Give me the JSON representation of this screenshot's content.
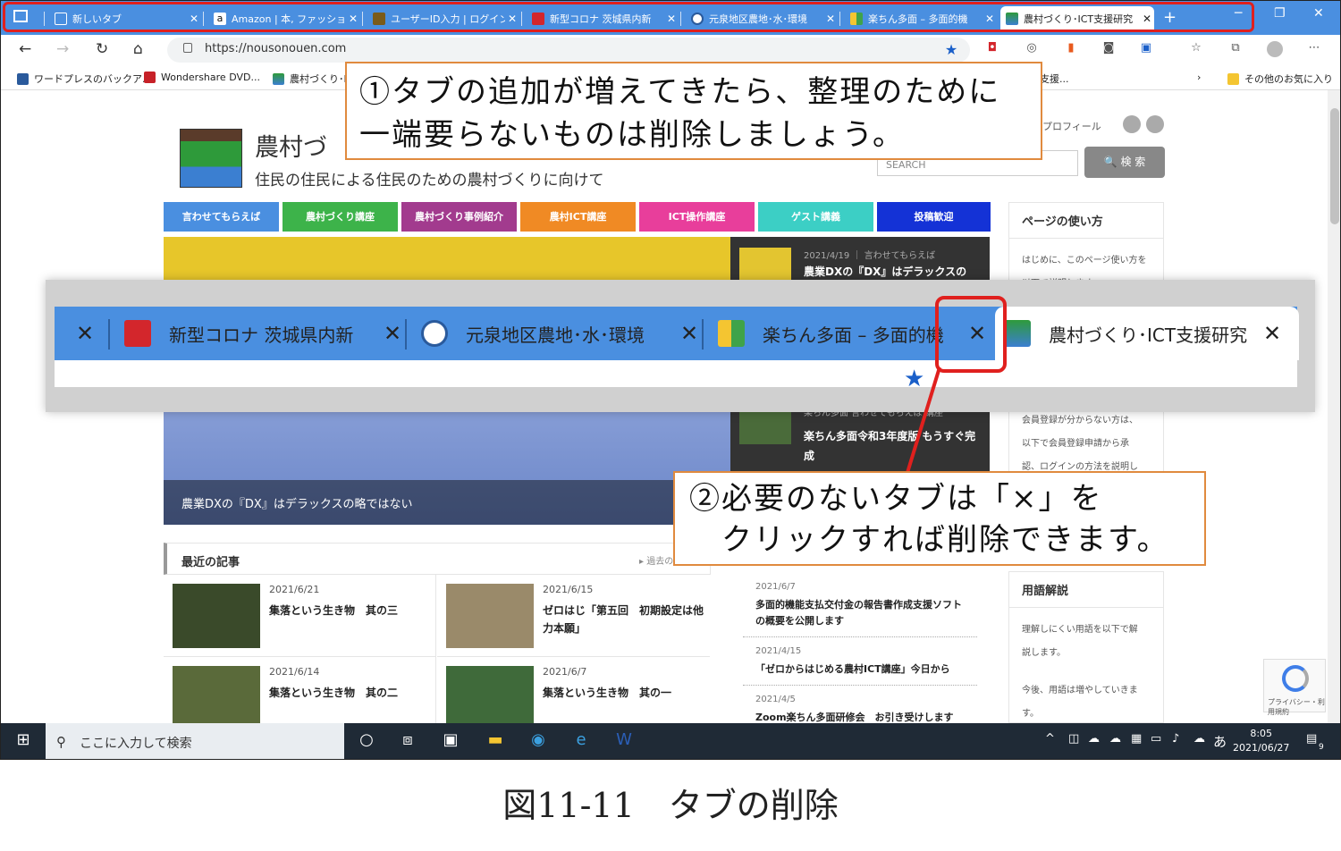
{
  "browser": {
    "tabs": [
      {
        "label": "新しいタブ",
        "color": "#ffffff"
      },
      {
        "label": "Amazon | 本, ファッション",
        "color": "#111111"
      },
      {
        "label": "ユーザーID入力 | ログイン",
        "color": "#7a5b1a"
      },
      {
        "label": "新型コロナ 茨城県内新",
        "color": "#d3262c"
      },
      {
        "label": "元泉地区農地･水･環境",
        "color": "#2a5a9c"
      },
      {
        "label": "楽ちん多面 – 多面的機",
        "color": "#f4c531"
      },
      {
        "label": "農村づくり･ICT支援研究",
        "color": "#3f9a3a"
      }
    ],
    "new_tab": "+",
    "window_controls": {
      "minimize": "─",
      "restore": "❐",
      "close": "✕"
    },
    "url": "https://nousonouen.com",
    "bookmarks": [
      {
        "label": "ワードプレスのバックア..."
      },
      {
        "label": "Wondershare DVD..."
      },
      {
        "label": "農村づくり･I("
      },
      {
        "label": "支援..."
      },
      {
        "label": "その他のお気に入り"
      }
    ]
  },
  "site": {
    "title": "農村づ",
    "tagline": "住民の住民による住民のための農村づくりに向けて",
    "profile": "プロフィール",
    "search_placeholder": "SEARCH",
    "search_button": "🔍 検 索",
    "nav": [
      {
        "label": "言わせてもらえば",
        "color": "#4a8fe0"
      },
      {
        "label": "農村づくり講座",
        "color": "#3db34a"
      },
      {
        "label": "農村づくり事例紹介",
        "color": "#a23b8e"
      },
      {
        "label": "農村ICT講座",
        "color": "#f08a24"
      },
      {
        "label": "ICT操作講座",
        "color": "#e83e9b"
      },
      {
        "label": "ゲスト講義",
        "color": "#3ccfc5"
      },
      {
        "label": "投稿歓迎",
        "color": "#1432d6"
      }
    ],
    "hero_caption": "農業DXの『DX』はデラックスの略ではない",
    "side_posts": [
      {
        "meta": "2021/4/19 ｜ 言わせてもらえば",
        "title": "農業DXの『DX』はデラックスの"
      },
      {
        "meta": "楽ちん多面 言わせてもらえば 講座",
        "title": "楽ちん多面令和3年度版 もうすぐ完成"
      }
    ],
    "page_usage": {
      "heading": "ページの使い方",
      "body": "はじめに、このページ使い方を以下で説明します。"
    },
    "member": {
      "body1": "会員登録が分からない方は、",
      "body2": "以下で会員登録申請から承",
      "body3": "認、ログインの方法を説明し"
    },
    "glossary": {
      "heading": "用語解説",
      "body1": "理解しにくい用語を以下で解",
      "body2": "説します。",
      "body3": "今後、用語は増やしていきま",
      "body4": "す。"
    },
    "recent_heading": "最近の記事",
    "recent_more": "▸ 過去の",
    "recent": [
      {
        "date": "2021/6/21",
        "title": "集落という生き物　其の三"
      },
      {
        "date": "2021/6/15",
        "title": "ゼロはじ「第五回　初期設定は他力本願」"
      },
      {
        "date": "2021/6/14",
        "title": "集落という生き物　其の二"
      },
      {
        "date": "2021/6/7",
        "title": "集落という生き物　其の一"
      }
    ],
    "news": [
      {
        "date": "2021/6/7",
        "title": "多面的機能支払交付金の報告書作成支援ソフトの概要を公開します"
      },
      {
        "date": "2021/4/15",
        "title": "「ゼロからはじめる農村ICT講座」今日から"
      },
      {
        "date": "2021/4/5",
        "title": "Zoom楽ちん多面研修会　お引き受けします"
      }
    ],
    "recaptcha_label": "プライバシー・利用規約"
  },
  "zoom": {
    "tabs": [
      {
        "label": "新型コロナ 茨城県内新",
        "color": "#d3262c"
      },
      {
        "label": "元泉地区農地･水･環境",
        "color": "#2a5a9c"
      },
      {
        "label": "楽ちん多面 – 多面的機",
        "color": "#f4c531"
      },
      {
        "label": "農村づくり･ICT支援研究",
        "color": "#3f9a3a"
      }
    ]
  },
  "callouts": {
    "one_line1": "①タブの追加が増えてきたら、整理のために",
    "one_line2": "一端要らないものは削除しましょう。",
    "two_line1": "②必要のないタブは「×」を",
    "two_line2": "　クリックすれば削除できます。"
  },
  "taskbar": {
    "search_placeholder": "ここに入力して検索",
    "time": "8:05",
    "date": "2021/06/27",
    "ime": "あ",
    "notifications": "9"
  },
  "caption": "図11-11　タブの削除"
}
